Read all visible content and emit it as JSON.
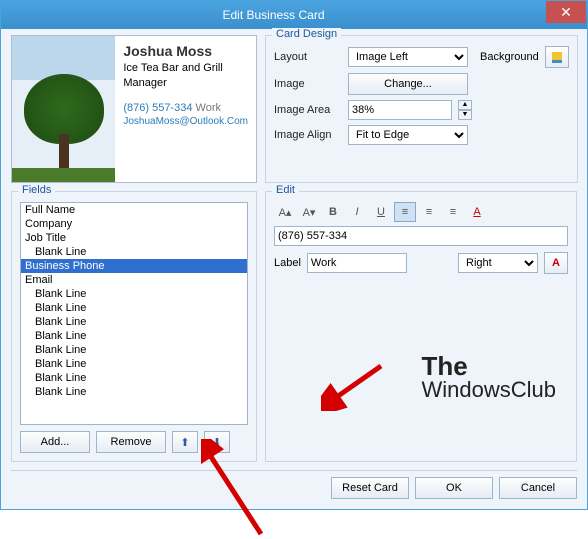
{
  "window": {
    "title": "Edit Business Card"
  },
  "preview": {
    "name": "Joshua Moss",
    "company": "Ice Tea Bar and Grill",
    "title": "Manager",
    "phone": "(876) 557-334",
    "phone_type": "Work",
    "email": "JoshuaMoss@Outlook.Com"
  },
  "cardDesign": {
    "legend": "Card Design",
    "layoutLabel": "Layout",
    "layoutValue": "Image Left",
    "backgroundLabel": "Background",
    "imageLabel": "Image",
    "changeBtn": "Change...",
    "areaLabel": "Image Area",
    "areaValue": "38%",
    "alignLabel": "Image Align",
    "alignValue": "Fit to Edge"
  },
  "fields": {
    "legend": "Fields",
    "items": [
      {
        "label": "Full Name",
        "indent": false,
        "sel": false
      },
      {
        "label": "Company",
        "indent": false,
        "sel": false
      },
      {
        "label": "Job Title",
        "indent": false,
        "sel": false
      },
      {
        "label": "Blank Line",
        "indent": true,
        "sel": false
      },
      {
        "label": "Business Phone",
        "indent": false,
        "sel": true
      },
      {
        "label": "Email",
        "indent": false,
        "sel": false
      },
      {
        "label": "Blank Line",
        "indent": true,
        "sel": false
      },
      {
        "label": "Blank Line",
        "indent": true,
        "sel": false
      },
      {
        "label": "Blank Line",
        "indent": true,
        "sel": false
      },
      {
        "label": "Blank Line",
        "indent": true,
        "sel": false
      },
      {
        "label": "Blank Line",
        "indent": true,
        "sel": false
      },
      {
        "label": "Blank Line",
        "indent": true,
        "sel": false
      },
      {
        "label": "Blank Line",
        "indent": true,
        "sel": false
      },
      {
        "label": "Blank Line",
        "indent": true,
        "sel": false
      }
    ],
    "addBtn": "Add...",
    "removeBtn": "Remove"
  },
  "edit": {
    "legend": "Edit",
    "value": "(876) 557-334",
    "labelLabel": "Label",
    "labelValue": "Work",
    "alignValue": "Right"
  },
  "footer": {
    "reset": "Reset Card",
    "ok": "OK",
    "cancel": "Cancel"
  },
  "watermark": {
    "line1": "The",
    "line2": "WindowsClub"
  }
}
